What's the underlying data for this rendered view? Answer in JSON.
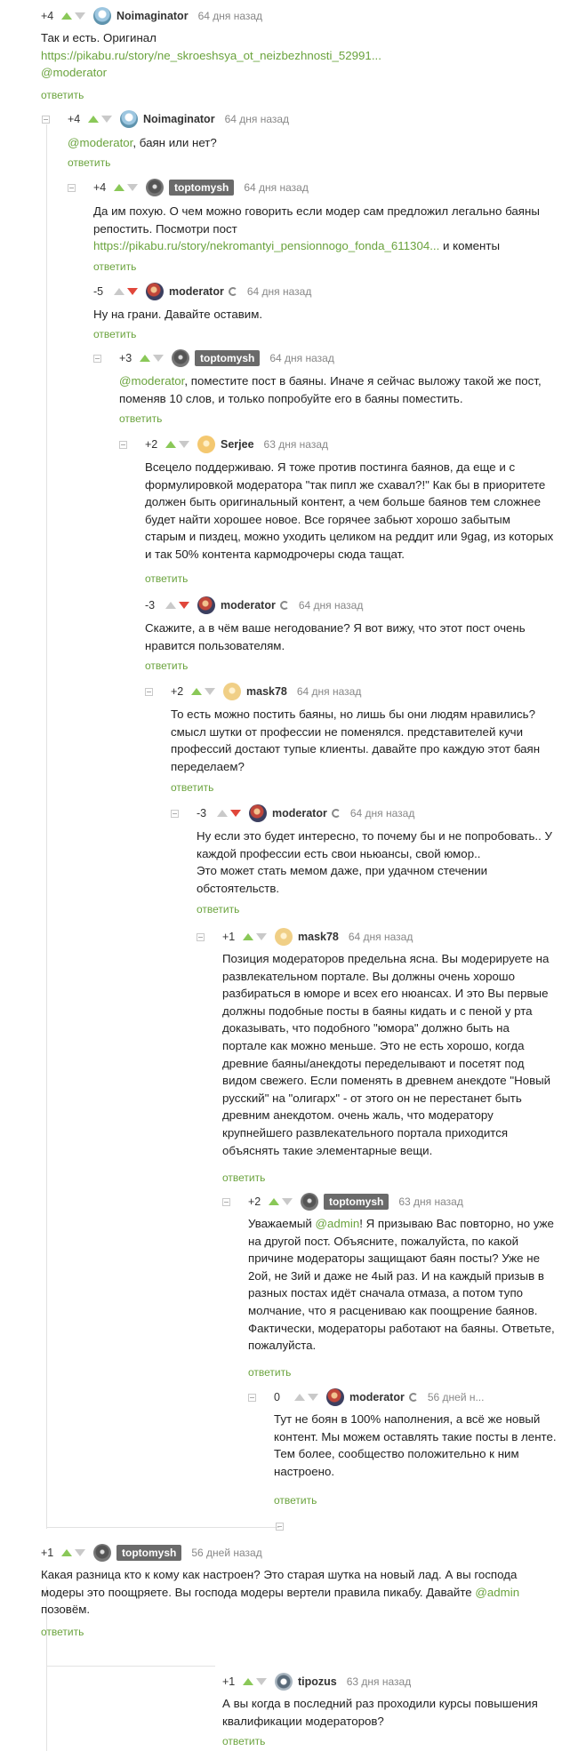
{
  "reply_label": "ответить",
  "comments": [
    {
      "rating": "+4",
      "user": "Noimaginator",
      "time": "64 дня назад",
      "text": "Так и есть. Оригинал",
      "link": "https://pikabu.ru/story/ne_skroeshsya_ot_neizbezhnosti_52991...",
      "mention": "@moderator"
    },
    {
      "rating": "+4",
      "user": "Noimaginator",
      "time": "64 дня назад",
      "mention": "@moderator",
      "text": ", баян или нет?"
    },
    {
      "rating": "+4",
      "user": "toptomysh",
      "time": "64 дня назад",
      "text": "Да им похую. О чем можно говорить если модер сам предложил легально баяны репостить. Посмотри пост",
      "link": "https://pikabu.ru/story/nekromantyi_pensionnogo_fonda_611304...",
      "tail": " и коменты"
    },
    {
      "rating": "-5",
      "user": "moderator",
      "time": "64 дня назад",
      "text": "Ну на грани. Давайте оставим."
    },
    {
      "rating": "+3",
      "user": "toptomysh",
      "time": "64 дня назад",
      "mention": "@moderator",
      "text": ", поместите пост в баяны. Иначе я сейчас выложу такой же пост, поменяв 10 слов, и только попробуйте его в баяны поместить."
    },
    {
      "rating": "+2",
      "user": "Serjee",
      "time": "63 дня назад",
      "text": "Всецело поддерживаю. Я тоже против постинга баянов, да еще и с формулировкой модератора \"так пипл же схавал?!\" Как бы в приоритете должен быть оригинальный контент, а чем больше баянов тем сложнее будет найти хорошее новое. Все горячее забьют хорошо забытым старым и пиздец, можно уходить целиком на реддит или 9gag, из которых и так 50% контента кармодрочеры сюда тащат."
    },
    {
      "rating": "-3",
      "user": "moderator",
      "time": "64 дня назад",
      "text": "Скажите, а в чём ваше негодование? Я вот вижу, что этот пост очень нравится пользователям."
    },
    {
      "rating": "+2",
      "user": "mask78",
      "time": "64 дня назад",
      "text": "То есть можно постить баяны, но лишь бы они людям нравились? смысл шутки от профессии не поменялся. представителей кучи профессий достают тупые клиенты. давайте про каждую этот баян переделаем?"
    },
    {
      "rating": "-3",
      "user": "moderator",
      "time": "64 дня назад",
      "text": "Ну если это будет интересно, то почему бы и не попробовать.. У каждой профессии есть свои ньюансы, свой юмор..\nЭто может стать мемом даже, при удачном стечении обстоятельств."
    },
    {
      "rating": "+1",
      "user": "mask78",
      "time": "64 дня назад",
      "text": "Позиция модераторов предельна ясна. Вы модерируете на развлекательном портале. Вы должны очень хорошо разбираться в юморе и всех его нюансах. И это Вы первые должны подобные посты в баяны кидать и с пеной у рта доказывать, что подобного \"юмора\" должно быть на портале как можно меньше. Это не есть хорошо, когда древние баяны/анекдоты переделывают и посетят под видом свежего. Если поменять в древнем анекдоте \"Новый русский\" на \"олигарх\" - от этого он не перестанет быть древним анекдотом. очень жаль, что модератору крупнейшего развлекательного портала приходится объяснять такие элементарные вещи."
    },
    {
      "rating": "+2",
      "user": "toptomysh",
      "time": "63 дня назад",
      "pre": "Уважаемый ",
      "mention": "@admin",
      "text": "! Я призываю Вас повторно, но уже на другой пост. Объясните, пожалуйста, по какой причине модераторы защищают баян посты? Уже не 2ой, не 3ий и даже не 4ый раз. И на каждый призыв в разных постах идёт сначала отмаза, а потом тупо молчание, что я расцениваю как поощрение баянов. Фактически, модераторы работают на баяны. Ответьте, пожалуйста."
    },
    {
      "rating": "0",
      "user": "moderator",
      "time": "56 дней н...",
      "text": "Тут не боян в 100% наполнения, а всё же новый контент.  Мы можем оставлять такие посты в ленте. Тем более, сообщество положительно к ним настроено."
    },
    {
      "rating": "+1",
      "user": "toptomysh",
      "time": "56 дней назад",
      "text": "Какая разница кто к кому как настроен? Это старая шутка на новый лад. А вы господа модеры это поощряете. Вы господа модеры вертели правила пикабу. Давайте ",
      "mention": "@admin",
      "tail": " позовём."
    },
    {
      "rating": "+1",
      "user": "tipozus",
      "time": "63 дня назад",
      "text": "А вы когда в последний раз проходили курсы повышения квалификации модераторов?"
    }
  ]
}
